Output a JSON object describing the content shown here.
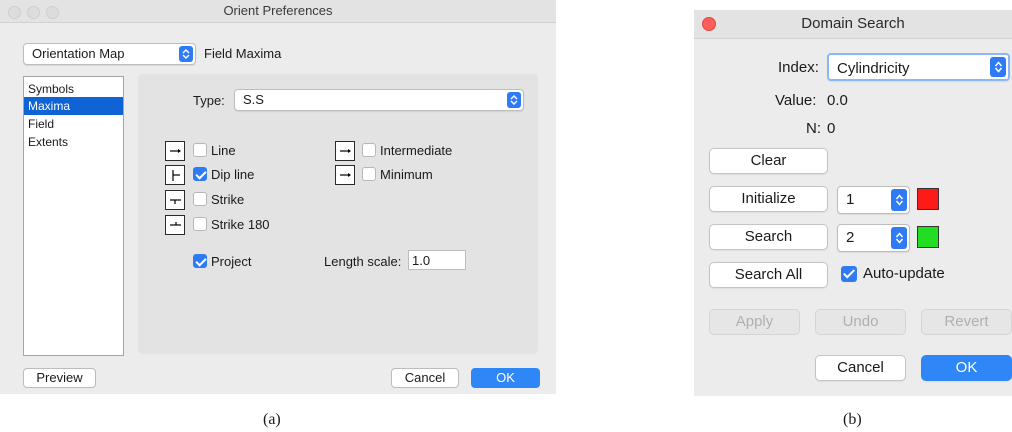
{
  "window_a": {
    "title": "Orient Preferences",
    "plot_type_select": {
      "value": "Orientation Map"
    },
    "field_label": "Field Maxima",
    "sidebar_items": [
      "Symbols",
      "Maxima",
      "Field",
      "Extents"
    ],
    "selected_sidebar_item": "Maxima",
    "type_label": "Type:",
    "type_select": {
      "value": "S.S"
    },
    "checkboxes": {
      "line": {
        "label": "Line",
        "checked": false
      },
      "dip_line": {
        "label": "Dip line",
        "checked": true
      },
      "strike": {
        "label": "Strike",
        "checked": false
      },
      "strike_180": {
        "label": "Strike 180",
        "checked": false
      },
      "intermediate": {
        "label": "Intermediate",
        "checked": false
      },
      "minimum": {
        "label": "Minimum",
        "checked": false
      },
      "project": {
        "label": "Project",
        "checked": true
      }
    },
    "length_scale_label": "Length scale:",
    "length_scale_value": "1.0",
    "buttons": {
      "preview": "Preview",
      "cancel": "Cancel",
      "ok": "OK"
    },
    "caption": "(a)"
  },
  "window_b": {
    "title": "Domain Search",
    "index_label": "Index:",
    "index_select": {
      "value": "Cylindricity"
    },
    "value_label": "Value:",
    "value": "0.0",
    "n_label": "N:",
    "n": "0",
    "buttons": {
      "clear": "Clear",
      "initialize": "Initialize",
      "search": "Search",
      "search_all": "Search All",
      "apply": "Apply",
      "undo": "Undo",
      "revert": "Revert",
      "cancel": "Cancel",
      "ok": "OK"
    },
    "initialize_select": {
      "value": "1"
    },
    "search_select": {
      "value": "2"
    },
    "auto_update": {
      "label": "Auto-update",
      "checked": true
    },
    "colors": {
      "initialize_swatch": "#ff1a1a",
      "search_swatch": "#22dd22",
      "close_button": "#ff5f57",
      "accent": "#2f86f6"
    },
    "caption": "(b)"
  }
}
